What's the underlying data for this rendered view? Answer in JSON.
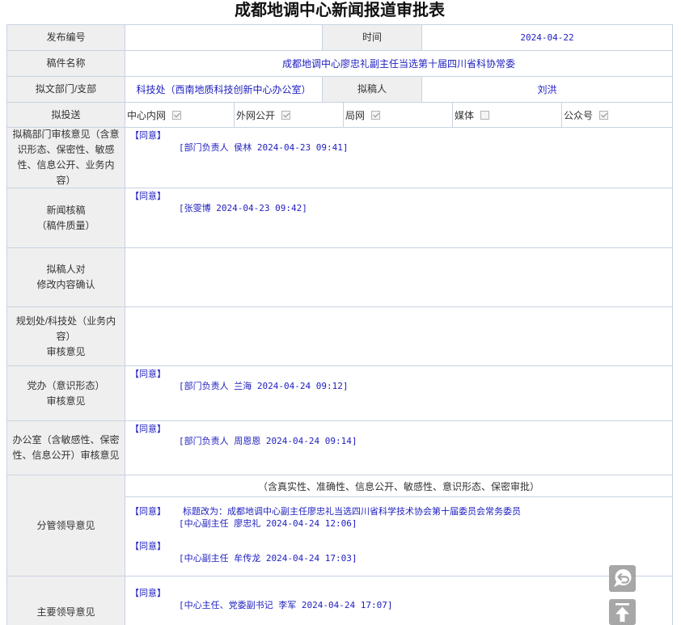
{
  "title": "成都地调中心新闻报道审批表",
  "header": {
    "release_no": {
      "label": "发布编号",
      "value": ""
    },
    "time": {
      "label": "时间",
      "value": "2024-04-22"
    },
    "manuscript_name": {
      "label": "稿件名称",
      "value": "成都地调中心廖忠礼副主任当选第十届四川省科协常委"
    },
    "department": {
      "label": "拟文部门/支部",
      "value": "科技处（西南地质科技创新中心办公室）"
    },
    "drafter": {
      "label": "拟稿人",
      "value": "刘洪"
    }
  },
  "delivery": {
    "label": "拟投送",
    "options": [
      {
        "label": "中心内网",
        "checked": true
      },
      {
        "label": "外网公开",
        "checked": true
      },
      {
        "label": "局网",
        "checked": true
      },
      {
        "label": "媒体",
        "checked": false
      },
      {
        "label": "公众号",
        "checked": true
      }
    ]
  },
  "opinions": [
    {
      "label": "拟稿部门审核意见（含意识形态、保密性、敏感性、信息公开、业务内容）",
      "entries": [
        {
          "verdict": "【同意】",
          "signature": "[部门负责人 侯林 2024-04-23 09:41]"
        }
      ]
    },
    {
      "label": "新闻核稿\n（稿件质量）",
      "entries": [
        {
          "verdict": "【同意】",
          "signature": "[张雯博 2024-04-23 09:42]"
        }
      ]
    },
    {
      "label": "拟稿人对\n修改内容确认",
      "entries": []
    },
    {
      "label": "规划处/科技处（业务内容）\n审核意见",
      "entries": []
    },
    {
      "label": "党办（意识形态）\n审核意见",
      "entries": [
        {
          "verdict": "【同意】",
          "signature": "[部门负责人 兰海 2024-04-24 09:12]"
        }
      ]
    },
    {
      "label": "办公室（含敏感性、保密性、信息公开）审核意见",
      "entries": [
        {
          "verdict": "【同意】",
          "signature": "[部门负责人 周恩恩 2024-04-24 09:14]"
        }
      ]
    },
    {
      "label": "分管领导意见",
      "subtitle": "（含真实性、准确性、信息公开、敏感性、意识形态、保密审批）",
      "entries": [
        {
          "verdict": "【同意】",
          "note": "标题改为：成都地调中心副主任廖忠礼当选四川省科学技术协会第十届委员会常务委员",
          "signature": "[中心副主任 廖忠礼 2024-04-24 12:06]"
        },
        {
          "verdict": "【同意】",
          "signature": "[中心副主任 牟传龙 2024-04-24 17:03]"
        }
      ]
    },
    {
      "label": "主要领导意见",
      "entries": [
        {
          "verdict": "【同意】",
          "signature": "[中心主任、党委副书记 李军 2024-04-24 17:07]"
        }
      ]
    }
  ],
  "floating_buttons": [
    {
      "icon": "back-icon"
    },
    {
      "icon": "back-to-top-icon"
    }
  ],
  "colors": {
    "value_text": "#1e1ec0",
    "label_bg": "#efefef",
    "border": "#c8d2e2",
    "float_button_bg": "#9c9c9c"
  }
}
